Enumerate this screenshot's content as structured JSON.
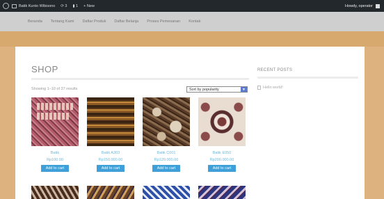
{
  "adminbar": {
    "site_name": "Batik Kunto Wibisono",
    "updates_count": "3",
    "comments_count": "1",
    "new_label": "New",
    "greeting": "Howdy, operator"
  },
  "nav": {
    "items": [
      "Beranda",
      "Tentang Kami",
      "Daftar Produk",
      "Daftar Belanja",
      "Proses Pemesanan",
      "Kontak"
    ]
  },
  "shop": {
    "title": "SHOP",
    "results_text": "Showing 1–10 of 37 results",
    "sort_selected": "Sort by popularity"
  },
  "products": [
    {
      "name": "Batik",
      "price": "Rp100.00",
      "button": "Add to cart"
    },
    {
      "name": "Batik A303",
      "price": "Rp150.000.00",
      "button": "Add to cart"
    },
    {
      "name": "Batik C001",
      "price": "Rp120.000.00",
      "button": "Add to cart"
    },
    {
      "name": "Batik E050",
      "price": "Rp200.000.00",
      "button": "Add to cart"
    }
  ],
  "sidebar": {
    "title": "RECENT POSTS",
    "posts": [
      "Hello world!"
    ]
  },
  "icons": {
    "wp_logo": "wordpress-logo-icon",
    "home": "home-icon",
    "updates": "refresh-icon",
    "comments": "comment-icon",
    "new": "plus-icon",
    "sort_arrow": "chevron-down-icon",
    "post": "document-icon"
  },
  "colors": {
    "admin_bar": "#23282d",
    "page_background": "#ddb27e",
    "button": "#3e9fd9",
    "link": "#6fb7d8"
  }
}
